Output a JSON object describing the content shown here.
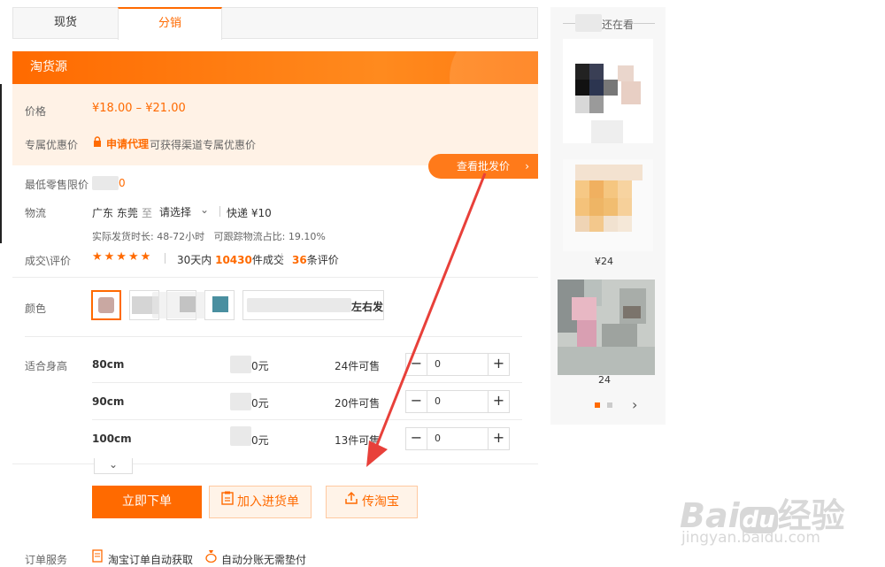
{
  "tabs": [
    "现货",
    "分销"
  ],
  "banner_title": "淘货源",
  "price": {
    "label": "价格",
    "value": "¥18.00 – ¥21.00"
  },
  "discount": {
    "label": "专属优惠价",
    "link": "申请代理",
    "text": "可获得渠道专属优惠价"
  },
  "batch_button": "查看批发价",
  "retail": {
    "label": "最低零售限价",
    "value": "0"
  },
  "logistics": {
    "label": "物流",
    "origin": "广东 东莞",
    "to": "至",
    "select": "请选择",
    "express": "快递 ¥10",
    "info": "实际发货时长: 48-72小时   可跟踪物流占比: 19.10%"
  },
  "rating": {
    "label": "成交\\评价",
    "stars": "★★★★★",
    "prefix": "30天内",
    "deals": "10430",
    "deals_suffix": "件成交",
    "reviews": "36",
    "reviews_suffix": "条评价"
  },
  "color": {
    "label": "颜色",
    "last_fragment": "左右发"
  },
  "size": {
    "label": "适合身高",
    "rows": [
      {
        "size": "80cm",
        "price": "0元",
        "stock": "24件可售",
        "qty": "0"
      },
      {
        "size": "90cm",
        "price": "0元",
        "stock": "20件可售",
        "qty": "0"
      },
      {
        "size": "100cm",
        "price": "0元",
        "stock": "13件可售",
        "qty": "0"
      }
    ]
  },
  "actions": {
    "order": "立即下单",
    "cart": "加入进货单",
    "upload": "传淘宝"
  },
  "service": {
    "label": "订单服务",
    "item1": "淘宝订单自动获取",
    "item2": "自动分账无需垫付"
  },
  "sidebar": {
    "title": "还在看",
    "price1": "¥24",
    "price2": "24"
  },
  "watermark": {
    "brand": "Bai",
    "brand2": "du",
    "cn": "经验",
    "url": "jingyan.baidu.com"
  }
}
